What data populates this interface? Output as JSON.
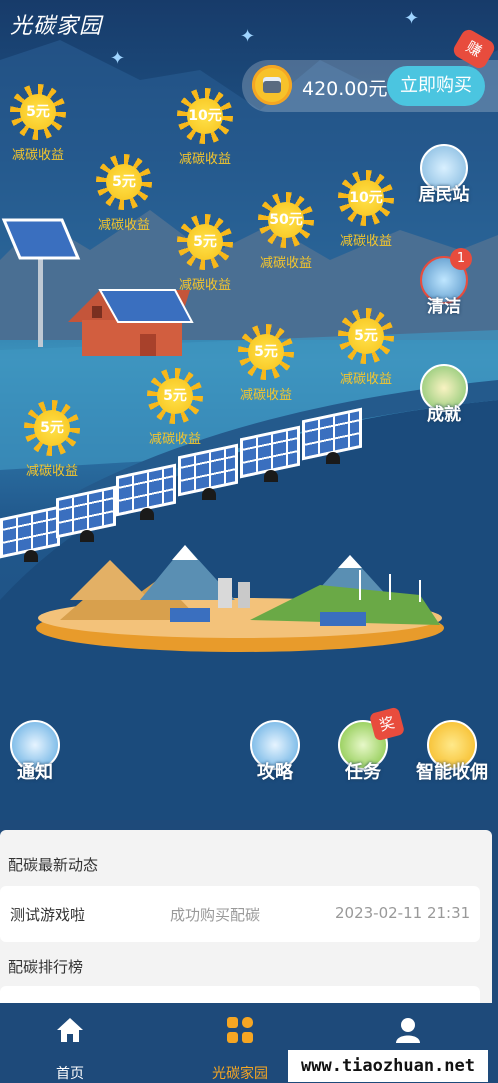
{
  "app_title": "光碳家园",
  "balance": {
    "amount": "420.00元",
    "buy_label": "立即购买",
    "earn_badge": "赚"
  },
  "suns": [
    {
      "value": "5元",
      "label": "减碳收益"
    },
    {
      "value": "10元",
      "label": "减碳收益"
    },
    {
      "value": "5元",
      "label": "减碳收益"
    },
    {
      "value": "10元",
      "label": "减碳收益"
    },
    {
      "value": "5元",
      "label": "减碳收益"
    },
    {
      "value": "50元",
      "label": "减碳收益"
    },
    {
      "value": "5元",
      "label": "减碳收益"
    },
    {
      "value": "5元",
      "label": "减碳收益"
    },
    {
      "value": "5元",
      "label": "减碳收益"
    },
    {
      "value": "5元",
      "label": "减碳收益"
    }
  ],
  "side_menu": [
    {
      "label": "居民站",
      "icon": "house-icon"
    },
    {
      "label": "清洁",
      "icon": "solar-clean-icon",
      "badge": "1"
    },
    {
      "label": "成就",
      "icon": "trophy-icon"
    }
  ],
  "bottom_actions": [
    {
      "label": "通知",
      "icon": "mail-icon"
    },
    {
      "label": "攻略",
      "icon": "book-icon"
    },
    {
      "label": "任务",
      "icon": "task-icon",
      "badge": "奖"
    },
    {
      "label": "智能收佣",
      "icon": "coin-icon"
    }
  ],
  "news": {
    "title": "配碳最新动态",
    "item": {
      "user": "测试游戏啦",
      "action": "成功购买配碳",
      "time": "2023-02-11 21:31"
    }
  },
  "ranking": {
    "title": "配碳排行榜"
  },
  "tabs": [
    {
      "label": "首页",
      "icon": "home-icon",
      "active": false
    },
    {
      "label": "光碳家园",
      "icon": "grid-icon",
      "active": true
    },
    {
      "label": "",
      "icon": "user-icon",
      "active": false
    }
  ],
  "watermark": "www.tiaozhuan.net",
  "colors": {
    "accent": "#4bc5e0",
    "sun": "#f7c21c",
    "badge": "#e84c3d",
    "active_tab": "#f5a623"
  }
}
